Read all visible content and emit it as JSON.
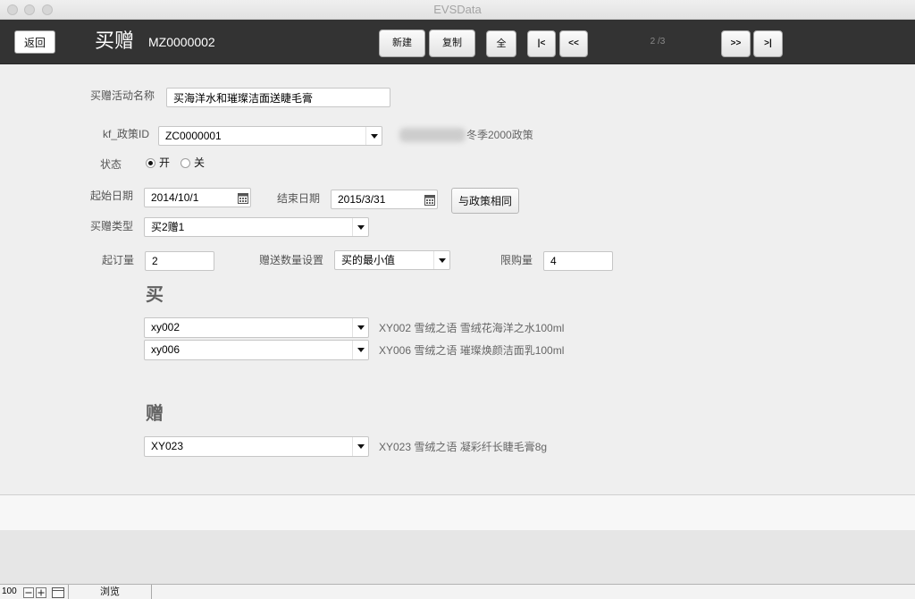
{
  "window": {
    "title": "EVSData"
  },
  "header": {
    "back_label": "返回",
    "page_title": "买赠",
    "record_id": "MZ0000002",
    "new_label": "新建",
    "copy_label": "复制",
    "all_label": "全",
    "first_label": "|<",
    "prev_label": "<<",
    "record_counter": "2 /3",
    "next_label": ">>",
    "last_label": ">|"
  },
  "form": {
    "activity_name": {
      "label": "买赠活动名称",
      "value": "买海洋水和璀璨洁面送睫毛膏"
    },
    "policy_id": {
      "label": "kf_政策ID",
      "value": "ZC0000001",
      "policy_name": "冬季2000政策"
    },
    "status": {
      "label": "状态",
      "options": [
        {
          "label": "开",
          "selected": true
        },
        {
          "label": "关",
          "selected": false
        }
      ]
    },
    "start_date": {
      "label": "起始日期",
      "value": "2014/10/1"
    },
    "end_date": {
      "label": "结束日期",
      "value": "2015/3/31"
    },
    "same_as_policy_label": "与政策相同",
    "gift_type": {
      "label": "买赠类型",
      "value": "买2赠1"
    },
    "min_order": {
      "label": "起订量",
      "value": "2"
    },
    "gift_qty_setting": {
      "label": "赠送数量设置",
      "value": "买的最小值"
    },
    "purchase_limit": {
      "label": "限购量",
      "value": "4"
    }
  },
  "buy_section": {
    "heading": "买",
    "items": [
      {
        "code": "xy002",
        "description": "XY002 雪绒之语 雪绒花海洋之水100ml"
      },
      {
        "code": "xy006",
        "description": "XY006 雪绒之语 璀璨焕颜洁面乳100ml"
      }
    ]
  },
  "gift_section": {
    "heading": "赠",
    "items": [
      {
        "code": "XY023",
        "description": "XY023 雪绒之语 凝彩纤长睫毛膏8g"
      }
    ]
  },
  "status_bar": {
    "zoom": "100",
    "mode": "浏览"
  },
  "icons": {
    "dropdown": "chevron-down-icon",
    "date_picker": "calendar-icon",
    "zoom_out": "zoom-out-icon",
    "zoom_in": "zoom-in-icon",
    "layout_toggle": "layout-icon"
  },
  "colors": {
    "header_bg": "#333333",
    "body_bg": "#efefef",
    "label_text": "#555555",
    "section_heading": "#626262",
    "description_text": "#666666"
  }
}
